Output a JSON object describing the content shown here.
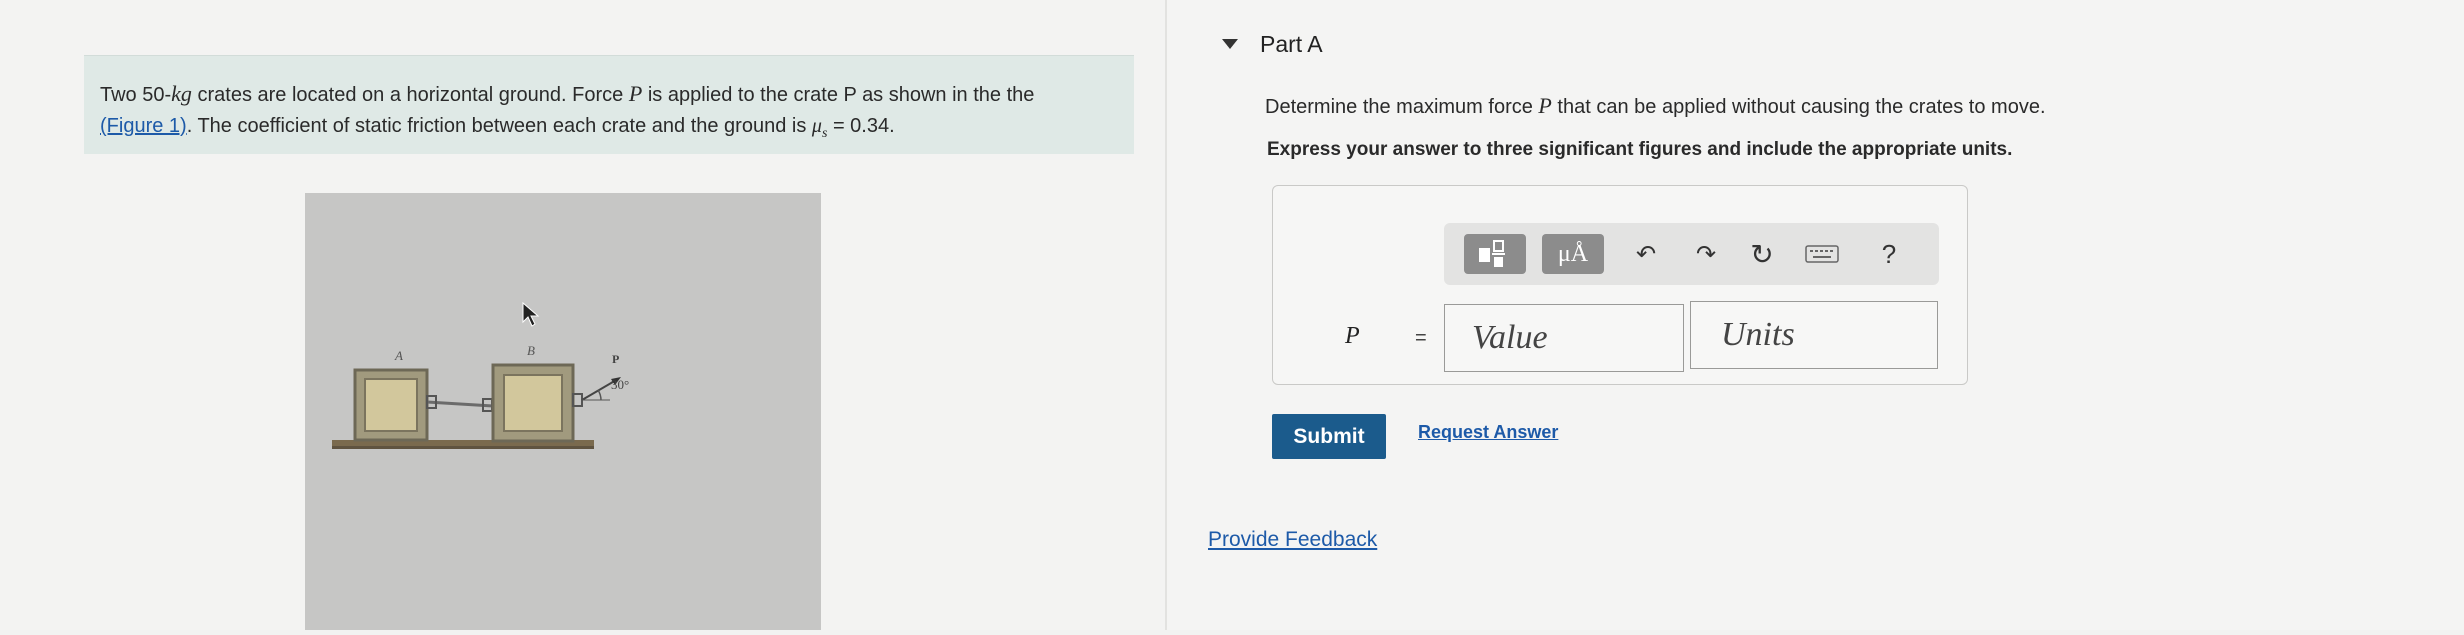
{
  "problem": {
    "text_before_mass": "Two 50-",
    "mass_unit": "kg",
    "text_after_mass": " crates are located on a horizontal ground. Force ",
    "force_symbol": "P",
    "text_after_force": " is applied to the crate P as shown in the the",
    "figure_link": "(Figure 1)",
    "text_friction": ". The coefficient of static friction between each crate and the ground is ",
    "mu_symbol": "μ",
    "mu_subscript": "s",
    "mu_value": " = 0.34."
  },
  "figure": {
    "label_a": "A",
    "label_b": "B",
    "label_p": "P",
    "angle_label": "30°"
  },
  "part": {
    "title": "Part A",
    "question_before": "Determine the maximum force ",
    "question_symbol": "P",
    "question_after": " that can be applied without causing the crates to move.",
    "instruction": "Express your answer to three significant figures and include the appropriate units."
  },
  "toolbar": {
    "units_label": "μÅ",
    "help_label": "?"
  },
  "answer": {
    "variable": "P",
    "equals": "=",
    "value_placeholder": "Value",
    "units_placeholder": "Units"
  },
  "actions": {
    "submit_label": "Submit",
    "request_answer_label": "Request Answer",
    "feedback_label": "Provide Feedback"
  },
  "colors": {
    "problem_bg": "#dfe9e6",
    "submit_bg": "#1b5b8c",
    "link": "#1d5aa8"
  }
}
